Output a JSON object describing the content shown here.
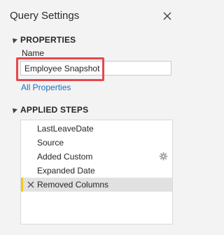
{
  "header": {
    "title": "Query Settings",
    "close_icon": "close-icon"
  },
  "properties": {
    "heading": "PROPERTIES",
    "name_label": "Name",
    "name_value": "Employee Snapshot",
    "all_properties_link": "All Properties"
  },
  "applied_steps": {
    "heading": "APPLIED STEPS",
    "items": [
      {
        "label": "LastLeaveDate",
        "selected": false,
        "icon": null
      },
      {
        "label": "Source",
        "selected": false,
        "icon": null
      },
      {
        "label": "Added Custom",
        "selected": false,
        "icon": "gear-icon"
      },
      {
        "label": "Expanded Date",
        "selected": false,
        "icon": null
      },
      {
        "label": "Removed Columns",
        "selected": true,
        "icon": "delete-x-icon"
      }
    ]
  },
  "colors": {
    "highlight_border": "#e8474c",
    "link": "#1a70c4",
    "selected_accent": "#f2c811",
    "selected_bg": "#e1e1e1",
    "panel_bg": "#f3f3f3"
  }
}
